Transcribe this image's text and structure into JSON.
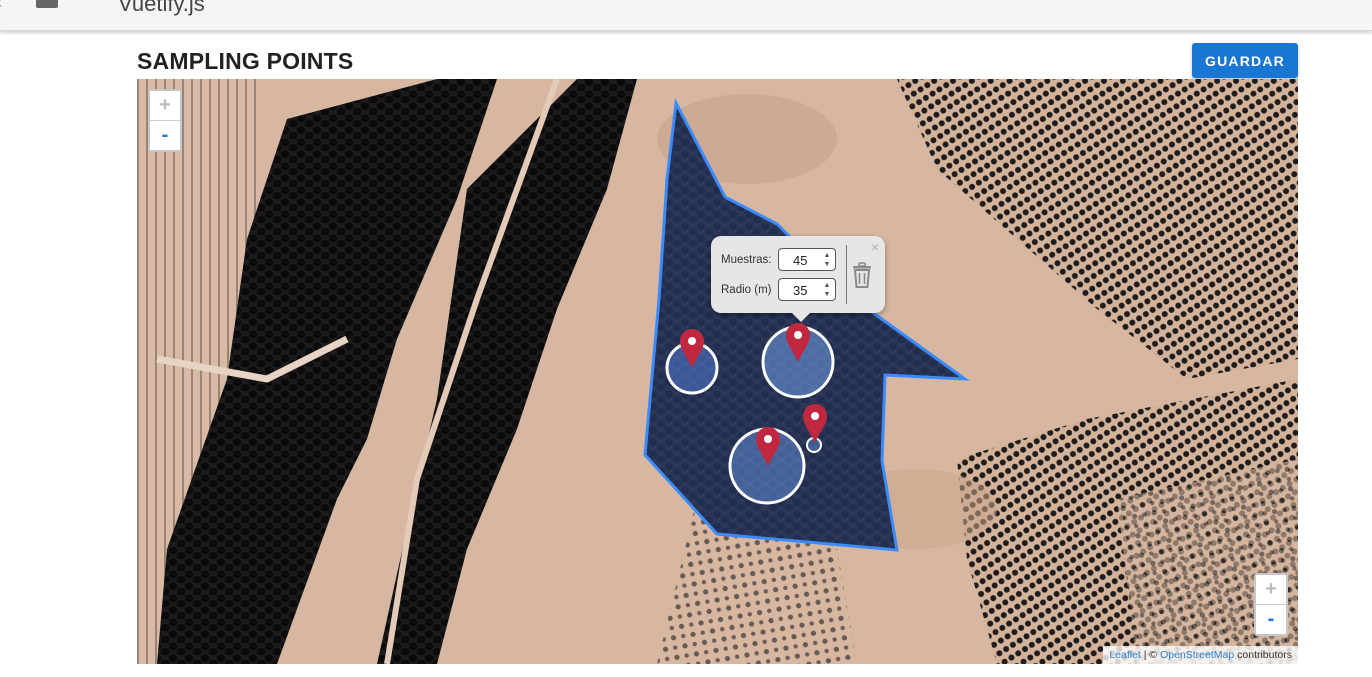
{
  "browser": {
    "app_title": "Vuetify.js"
  },
  "page": {
    "title": "SAMPLING POINTS"
  },
  "toolbar": {
    "save_label": "GUARDAR"
  },
  "map": {
    "zoom_in_label": "+",
    "zoom_out_label": "-",
    "attribution": {
      "leaflet": "Leaflet",
      "separator": " | © ",
      "osm": "OpenStreetMap",
      "suffix": " contributors"
    },
    "polygon_color": "#3b8bff",
    "marker_color": "#c0283f"
  },
  "popup": {
    "muestras_label": "Muestras:",
    "muestras_value": "45",
    "radio_label": "Radio (m)",
    "radio_value": "35",
    "close_label": "×"
  },
  "icons": [
    "back-icon",
    "app-icon",
    "trash-icon",
    "close-icon",
    "map-marker-icon"
  ]
}
